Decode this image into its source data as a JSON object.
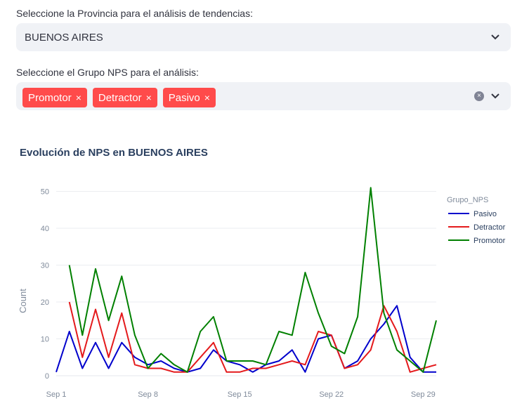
{
  "province": {
    "label": "Seleccione la Provincia para el análisis de tendencias:",
    "value": "BUENOS AIRES"
  },
  "nps_group": {
    "label": "Seleccione el Grupo NPS para el análisis:",
    "tags": [
      "Promotor",
      "Detractor",
      "Pasivo"
    ],
    "remove_glyph": "×"
  },
  "chart_data": {
    "type": "line",
    "title": "Evolución de NPS en BUENOS AIRES",
    "xlabel": "",
    "ylabel": "Count",
    "x_ticks": [
      "Sep 1",
      "Sep 8",
      "Sep 15",
      "Sep 22",
      "Sep 29"
    ],
    "y_ticks": [
      0,
      10,
      20,
      30,
      40,
      50
    ],
    "ylim": [
      0,
      52
    ],
    "x_days": [
      1,
      30
    ],
    "legend_title": "Grupo_NPS",
    "legend_position": "top-right",
    "grid": true,
    "x": [
      1,
      2,
      3,
      4,
      5,
      6,
      7,
      8,
      9,
      10,
      11,
      12,
      13,
      14,
      15,
      16,
      17,
      18,
      19,
      20,
      21,
      22,
      23,
      24,
      25,
      26,
      27,
      28,
      29,
      30
    ],
    "series": [
      {
        "name": "Pasivo",
        "color": "#0000cc",
        "values": [
          1,
          12,
          2,
          9,
          2,
          9,
          5,
          3,
          4,
          2,
          1,
          2,
          7,
          4,
          3,
          1,
          3,
          4,
          7,
          1,
          10,
          11,
          2,
          4,
          10,
          14,
          19,
          5,
          1,
          1
        ]
      },
      {
        "name": "Detractor",
        "color": "#e41a1c",
        "values": [
          null,
          20,
          5,
          18,
          5,
          17,
          3,
          2,
          2,
          1,
          1,
          5,
          9,
          1,
          1,
          2,
          2,
          3,
          4,
          3,
          12,
          11,
          2,
          3,
          7,
          19,
          12,
          1,
          2,
          3
        ]
      },
      {
        "name": "Promotor",
        "color": "#008000",
        "values": [
          null,
          30,
          11,
          29,
          15,
          27,
          11,
          2,
          6,
          3,
          1,
          12,
          16,
          4,
          4,
          4,
          3,
          12,
          11,
          28,
          17,
          8,
          6,
          16,
          51,
          17,
          7,
          4,
          1,
          15
        ]
      }
    ]
  }
}
